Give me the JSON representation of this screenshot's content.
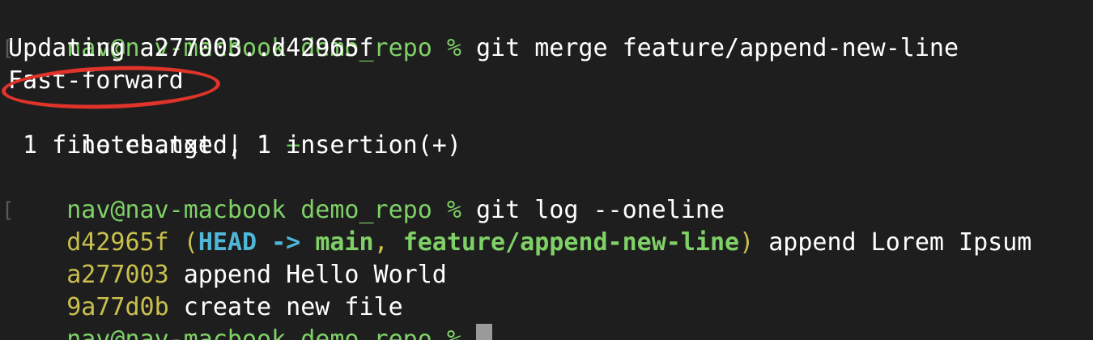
{
  "terminal": {
    "colors": {
      "background": "#1e1e1e",
      "prompt": "#7fd167",
      "hash": "#c9c04c",
      "head": "#4fb8d8",
      "annotation": "#e0332a",
      "cursor": "#9a9a9a"
    },
    "bracket_glyph": "[",
    "lines": {
      "l1": {
        "prompt": "nav@nav-macbook demo_repo %",
        "command": " git merge feature/append-new-line"
      },
      "l2": {
        "text": "Updating a277003..d42965f"
      },
      "l3": {
        "text": "Fast-forward"
      },
      "l4": {
        "file": " notes.txt | 1 ",
        "plus": "+"
      },
      "l5": {
        "text": " 1 file changed, 1 insertion(+)"
      },
      "l6": {
        "prompt": "nav@nav-macbook demo_repo %",
        "command": " git log --oneline"
      },
      "l7": {
        "hash": "d42965f",
        "open": " (",
        "head": "HEAD -> ",
        "main": "main",
        "sep": ", ",
        "feature": "feature/append-new-line",
        "close": ")",
        "message": " append Lorem Ipsum"
      },
      "l8": {
        "hash": "a277003",
        "message": " append Hello World"
      },
      "l9": {
        "hash": "9a77d0b",
        "message": " create new file"
      },
      "l10": {
        "prompt": "nav@nav-macbook demo_repo %",
        "space": " "
      }
    }
  }
}
